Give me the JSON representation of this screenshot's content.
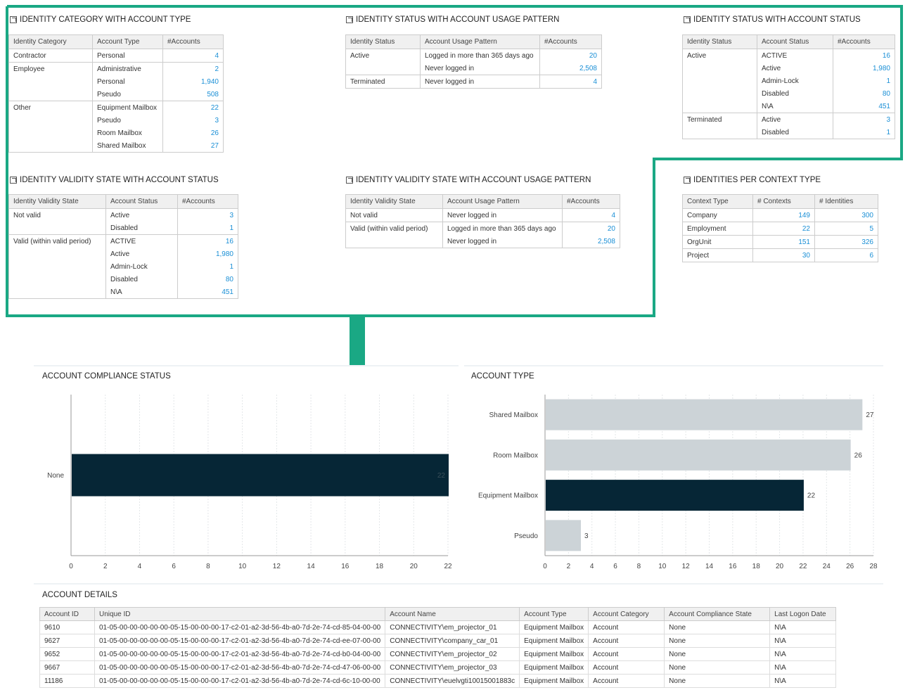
{
  "panels": {
    "cat_type": {
      "title": "IDENTITY CATEGORY WITH ACCOUNT TYPE",
      "headers": [
        "Identity Category",
        "Account Type",
        "#Accounts"
      ],
      "rows": [
        {
          "group": "Contractor",
          "sub": "Personal",
          "value": "4",
          "first": true
        },
        {
          "group": "Employee",
          "sub": "Administrative",
          "value": "2",
          "first": true
        },
        {
          "group": "",
          "sub": "Personal",
          "value": "1,940"
        },
        {
          "group": "",
          "sub": "Pseudo",
          "value": "508"
        },
        {
          "group": "Other",
          "sub": "Equipment Mailbox",
          "value": "22",
          "first": true
        },
        {
          "group": "",
          "sub": "Pseudo",
          "value": "3"
        },
        {
          "group": "",
          "sub": "Room Mailbox",
          "value": "26"
        },
        {
          "group": "",
          "sub": "Shared Mailbox",
          "value": "27"
        }
      ]
    },
    "status_usage": {
      "title": "IDENTITY STATUS WITH ACCOUNT USAGE PATTERN",
      "headers": [
        "Identity Status",
        "Account Usage Pattern",
        "#Accounts"
      ],
      "rows": [
        {
          "group": "Active",
          "sub": "Logged in more than 365 days ago",
          "value": "20",
          "first": true
        },
        {
          "group": "",
          "sub": "Never logged in",
          "value": "2,508"
        },
        {
          "group": "Terminated",
          "sub": "Never logged in",
          "value": "4",
          "first": true
        }
      ]
    },
    "status_status": {
      "title": "IDENTITY STATUS WITH ACCOUNT STATUS",
      "headers": [
        "Identity Status",
        "Account Status",
        "#Accounts"
      ],
      "rows": [
        {
          "group": "Active",
          "sub": "ACTIVE",
          "value": "16",
          "first": true
        },
        {
          "group": "",
          "sub": "Active",
          "value": "1,980"
        },
        {
          "group": "",
          "sub": "Admin-Lock",
          "value": "1"
        },
        {
          "group": "",
          "sub": "Disabled",
          "value": "80"
        },
        {
          "group": "",
          "sub": "N\\A",
          "value": "451"
        },
        {
          "group": "Terminated",
          "sub": "Active",
          "value": "3",
          "first": true
        },
        {
          "group": "",
          "sub": "Disabled",
          "value": "1"
        }
      ]
    },
    "validity_status": {
      "title": "IDENTITY VALIDITY STATE WITH ACCOUNT STATUS",
      "headers": [
        "Identity Validity State",
        "Account Status",
        "#Accounts"
      ],
      "rows": [
        {
          "group": "Not valid",
          "sub": "Active",
          "value": "3",
          "first": true
        },
        {
          "group": "",
          "sub": "Disabled",
          "value": "1"
        },
        {
          "group": "Valid (within valid period)",
          "sub": "ACTIVE",
          "value": "16",
          "first": true
        },
        {
          "group": "",
          "sub": "Active",
          "value": "1,980"
        },
        {
          "group": "",
          "sub": "Admin-Lock",
          "value": "1"
        },
        {
          "group": "",
          "sub": "Disabled",
          "value": "80"
        },
        {
          "group": "",
          "sub": "N\\A",
          "value": "451"
        }
      ]
    },
    "validity_usage": {
      "title": "IDENTITY VALIDITY STATE WITH ACCOUNT USAGE PATTERN",
      "headers": [
        "Identity Validity State",
        "Account Usage Pattern",
        "#Accounts"
      ],
      "rows": [
        {
          "group": "Not valid",
          "sub": "Never logged in",
          "value": "4",
          "first": true
        },
        {
          "group": "Valid (within valid period)",
          "sub": "Logged in more than 365 days ago",
          "value": "20",
          "first": true
        },
        {
          "group": "",
          "sub": "Never logged in",
          "value": "2,508"
        }
      ]
    },
    "context": {
      "title": "IDENTITIES PER CONTEXT TYPE",
      "headers": [
        "Context Type",
        "# Contexts",
        "# Identities"
      ],
      "rows": [
        {
          "name": "Company",
          "contexts": "149",
          "identities": "300"
        },
        {
          "name": "Employment",
          "contexts": "22",
          "identities": "5"
        },
        {
          "name": "OrgUnit",
          "contexts": "151",
          "identities": "326"
        },
        {
          "name": "Project",
          "contexts": "30",
          "identities": "6"
        }
      ]
    }
  },
  "chart_data": [
    {
      "type": "bar",
      "title": "ACCOUNT COMPLIANCE STATUS",
      "orientation": "horizontal",
      "categories": [
        "None"
      ],
      "values": [
        22
      ],
      "xlim": [
        0,
        22
      ],
      "ticks": [
        "0",
        "2",
        "4",
        "6",
        "8",
        "10",
        "12",
        "14",
        "16",
        "18",
        "20",
        "22"
      ],
      "value_labels": [
        "22"
      ],
      "grid": true,
      "colors": [
        "#062636"
      ]
    },
    {
      "type": "bar",
      "title": "ACCOUNT TYPE",
      "orientation": "horizontal",
      "categories": [
        "Shared Mailbox",
        "Room Mailbox",
        "Equipment Mailbox",
        "Pseudo"
      ],
      "values": [
        27,
        26,
        22,
        3
      ],
      "xlim": [
        0,
        28
      ],
      "ticks": [
        "0",
        "2",
        "4",
        "6",
        "8",
        "10",
        "12",
        "14",
        "16",
        "18",
        "20",
        "22",
        "24",
        "26",
        "28"
      ],
      "value_labels": [
        "27",
        "26",
        "22",
        "3"
      ],
      "grid": true,
      "colors": [
        "#ccd3d7",
        "#ccd3d7",
        "#062636",
        "#ccd3d7"
      ]
    }
  ],
  "details": {
    "title": "ACCOUNT DETAILS",
    "headers": [
      "Account ID",
      "Unique ID",
      "Account Name",
      "Account Type",
      "Account Category",
      "Account Compliance State",
      "Last Logon Date"
    ],
    "rows": [
      [
        "9610",
        "01-05-00-00-00-00-00-05-15-00-00-00-17-c2-01-a2-3d-56-4b-a0-7d-2e-74-cd-85-04-00-00",
        "CONNECTIVITY\\em_projector_01",
        "Equipment Mailbox",
        "Account",
        "None",
        "N\\A"
      ],
      [
        "9627",
        "01-05-00-00-00-00-00-05-15-00-00-00-17-c2-01-a2-3d-56-4b-a0-7d-2e-74-cd-ee-07-00-00",
        "CONNECTIVITY\\company_car_01",
        "Equipment Mailbox",
        "Account",
        "None",
        "N\\A"
      ],
      [
        "9652",
        "01-05-00-00-00-00-00-05-15-00-00-00-17-c2-01-a2-3d-56-4b-a0-7d-2e-74-cd-b0-04-00-00",
        "CONNECTIVITY\\em_projector_02",
        "Equipment Mailbox",
        "Account",
        "None",
        "N\\A"
      ],
      [
        "9667",
        "01-05-00-00-00-00-00-05-15-00-00-00-17-c2-01-a2-3d-56-4b-a0-7d-2e-74-cd-47-06-00-00",
        "CONNECTIVITY\\em_projector_03",
        "Equipment Mailbox",
        "Account",
        "None",
        "N\\A"
      ],
      [
        "11186",
        "01-05-00-00-00-00-00-05-15-00-00-00-17-c2-01-a2-3d-56-4b-a0-7d-2e-74-cd-6c-10-00-00",
        "CONNECTIVITY\\euelvgti10015001883c",
        "Equipment Mailbox",
        "Account",
        "None",
        "N\\A"
      ]
    ]
  },
  "colors": {
    "highlight": "#1aa884",
    "link": "#1a8fd6",
    "bar_dark": "#062636",
    "bar_light": "#ccd3d7"
  }
}
